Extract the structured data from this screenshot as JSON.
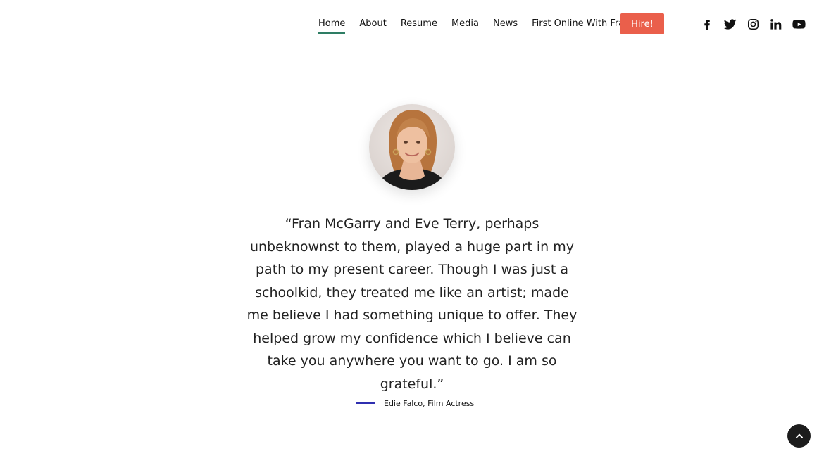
{
  "nav": {
    "items": [
      {
        "label": "Home",
        "active": true
      },
      {
        "label": "About",
        "active": false
      },
      {
        "label": "Resume",
        "active": false
      },
      {
        "label": "Media",
        "active": false
      },
      {
        "label": "News",
        "active": false
      },
      {
        "label": "First Online With Fran",
        "active": false
      }
    ],
    "hire_label": "Hire!"
  },
  "social": [
    "facebook-icon",
    "twitter-icon",
    "instagram-icon",
    "linkedin-icon",
    "youtube-icon"
  ],
  "testimonial": {
    "quote": "“Fran McGarry and Eve Terry, perhaps unbeknownst to them, played a huge part in my path to my present career. Though I was just a schoolkid, they treated me like an artist; made me believe I had something unique to offer. They helped grow my confidence which I believe can take you anywhere you want to go. I am so grateful.”",
    "author": "Edie Falco, Film Actress"
  },
  "colors": {
    "accent_button": "#ea5f4b",
    "nav_underline": "#2e7d64",
    "author_line": "#2f2fb0",
    "to_top_bg": "#1c1c1c"
  }
}
